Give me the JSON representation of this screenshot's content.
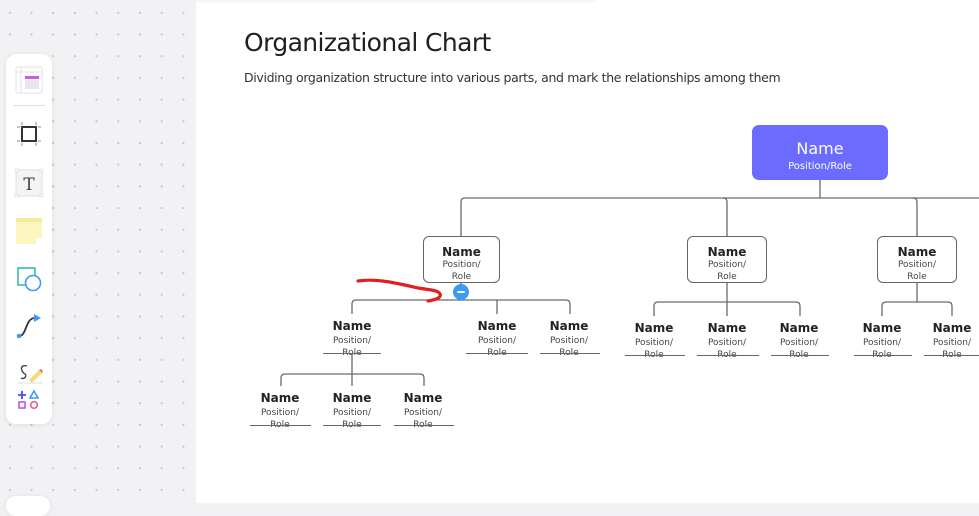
{
  "toolbar": {
    "tools": [
      {
        "name": "templates",
        "icon": "template-icon"
      },
      {
        "name": "frame",
        "icon": "frame-icon"
      },
      {
        "name": "text",
        "icon": "text-icon",
        "glyph": "T"
      },
      {
        "name": "sticky-note",
        "icon": "sticky-note-icon"
      },
      {
        "name": "shapes",
        "icon": "shapes-icon"
      },
      {
        "name": "connector",
        "icon": "connector-icon"
      },
      {
        "name": "pen",
        "icon": "pen-icon"
      },
      {
        "name": "more-shapes",
        "icon": "more-shapes-icon"
      }
    ]
  },
  "page": {
    "title": "Organizational Chart",
    "subtitle": "Dividing organization structure into various parts, and mark the relationships among them"
  },
  "colors": {
    "root_fill": "#6b6bff",
    "connector": "#666666",
    "collapse_button": "#3a9bf4",
    "annotation": "#e02020"
  },
  "org": {
    "root": {
      "name": "Name",
      "role": "Position/Role"
    },
    "level1": [
      {
        "name": "Name",
        "role_line1": "Position/",
        "role_line2": "Role"
      },
      {
        "name": "Name",
        "role_line1": "Position/",
        "role_line2": "Role"
      },
      {
        "name": "Name",
        "role_line1": "Position/",
        "role_line2": "Role"
      }
    ],
    "level2_a": [
      {
        "name": "Name",
        "role_line1": "Position/",
        "role_line2": "Role"
      },
      {
        "name": "Name",
        "role_line1": "Position/",
        "role_line2": "Role"
      },
      {
        "name": "Name",
        "role_line1": "Position/",
        "role_line2": "Role"
      }
    ],
    "level2_b": [
      {
        "name": "Name",
        "role_line1": "Position/",
        "role_line2": "Role"
      },
      {
        "name": "Name",
        "role_line1": "Position/",
        "role_line2": "Role"
      },
      {
        "name": "Name",
        "role_line1": "Position/",
        "role_line2": "Role"
      }
    ],
    "level2_c": [
      {
        "name": "Name",
        "role_line1": "Position/",
        "role_line2": "Role"
      },
      {
        "name": "Name",
        "role_line1": "Position/",
        "role_line2": "Role"
      }
    ],
    "level3_a": [
      {
        "name": "Name",
        "role_line1": "Position/",
        "role_line2": "Role"
      },
      {
        "name": "Name",
        "role_line1": "Position/",
        "role_line2": "Role"
      },
      {
        "name": "Name",
        "role_line1": "Position/",
        "role_line2": "Role"
      }
    ]
  }
}
